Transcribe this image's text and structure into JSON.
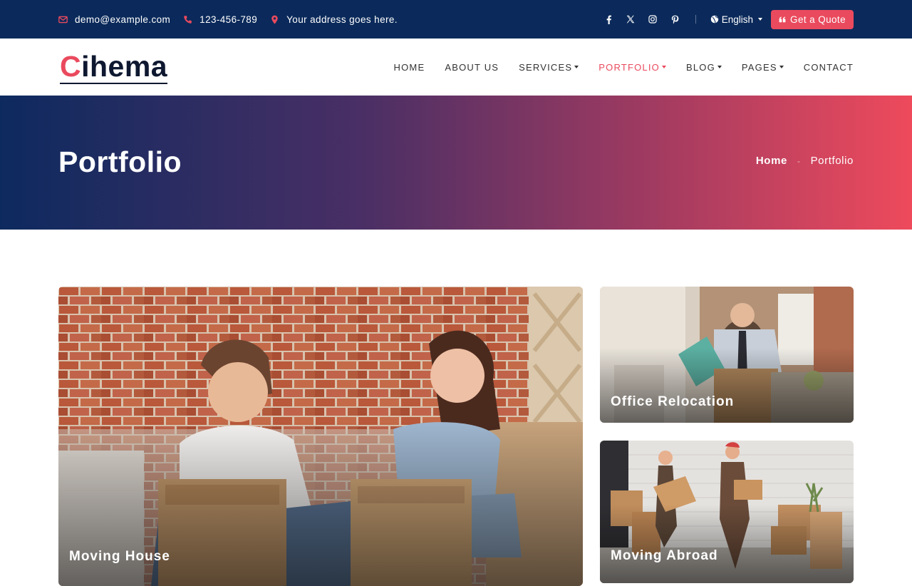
{
  "topbar": {
    "email": "demo@example.com",
    "phone": "123-456-789",
    "address": "Your address goes here.",
    "social_icons": [
      "facebook-icon",
      "x-twitter-icon",
      "instagram-icon",
      "pinterest-icon"
    ],
    "language": "English",
    "quote_label": "Get a Quote"
  },
  "logo": {
    "first_letter": "C",
    "rest": "ihema"
  },
  "nav": {
    "items": [
      {
        "label": "HOME",
        "dropdown": false,
        "active": false
      },
      {
        "label": "ABOUT US",
        "dropdown": false,
        "active": false
      },
      {
        "label": "SERVICES",
        "dropdown": true,
        "active": false
      },
      {
        "label": "PORTFOLIO",
        "dropdown": true,
        "active": true
      },
      {
        "label": "BLOG",
        "dropdown": true,
        "active": false
      },
      {
        "label": "PAGES",
        "dropdown": true,
        "active": false
      },
      {
        "label": "CONTACT",
        "dropdown": false,
        "active": false
      }
    ]
  },
  "hero": {
    "title": "Portfolio",
    "breadcrumb": {
      "home": "Home",
      "separator": "-",
      "current": "Portfolio"
    }
  },
  "portfolio": {
    "items": [
      {
        "title": "Moving House"
      },
      {
        "title": "Office Relocation"
      },
      {
        "title": "Moving Abroad"
      }
    ]
  },
  "colors": {
    "topbar_bg": "#0b2a5b",
    "accent": "#ea4a5e",
    "hero_gradient_start": "#0d2a5f",
    "hero_gradient_end": "#ee4a5c"
  }
}
